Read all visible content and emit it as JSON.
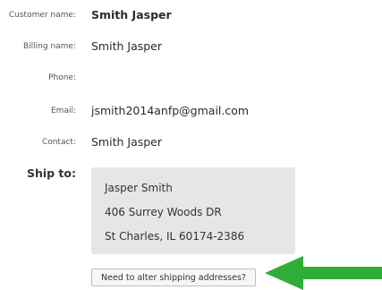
{
  "customer": {
    "customer_name_label": "Customer name:",
    "customer_name": "Smith Jasper",
    "billing_name_label": "Billing name:",
    "billing_name": "Smith Jasper",
    "phone_label": "Phone:",
    "phone": "",
    "email_label": "Email:",
    "email": "jsmith2014anfp@gmail.com",
    "contact_label": "Contact:",
    "contact": "Smith Jasper"
  },
  "ship_to": {
    "label": "Ship to:",
    "address_lines": [
      "Jasper Smith",
      "406 Surrey Woods DR",
      "St Charles, IL 60174-2386"
    ]
  },
  "actions": {
    "alter_shipping_label": "Need to alter shipping addresses?"
  },
  "colors": {
    "arrow": "#2fae37",
    "ship_box_bg": "#e6e6e6"
  },
  "icons": {
    "arrow": "left-arrow-icon"
  }
}
